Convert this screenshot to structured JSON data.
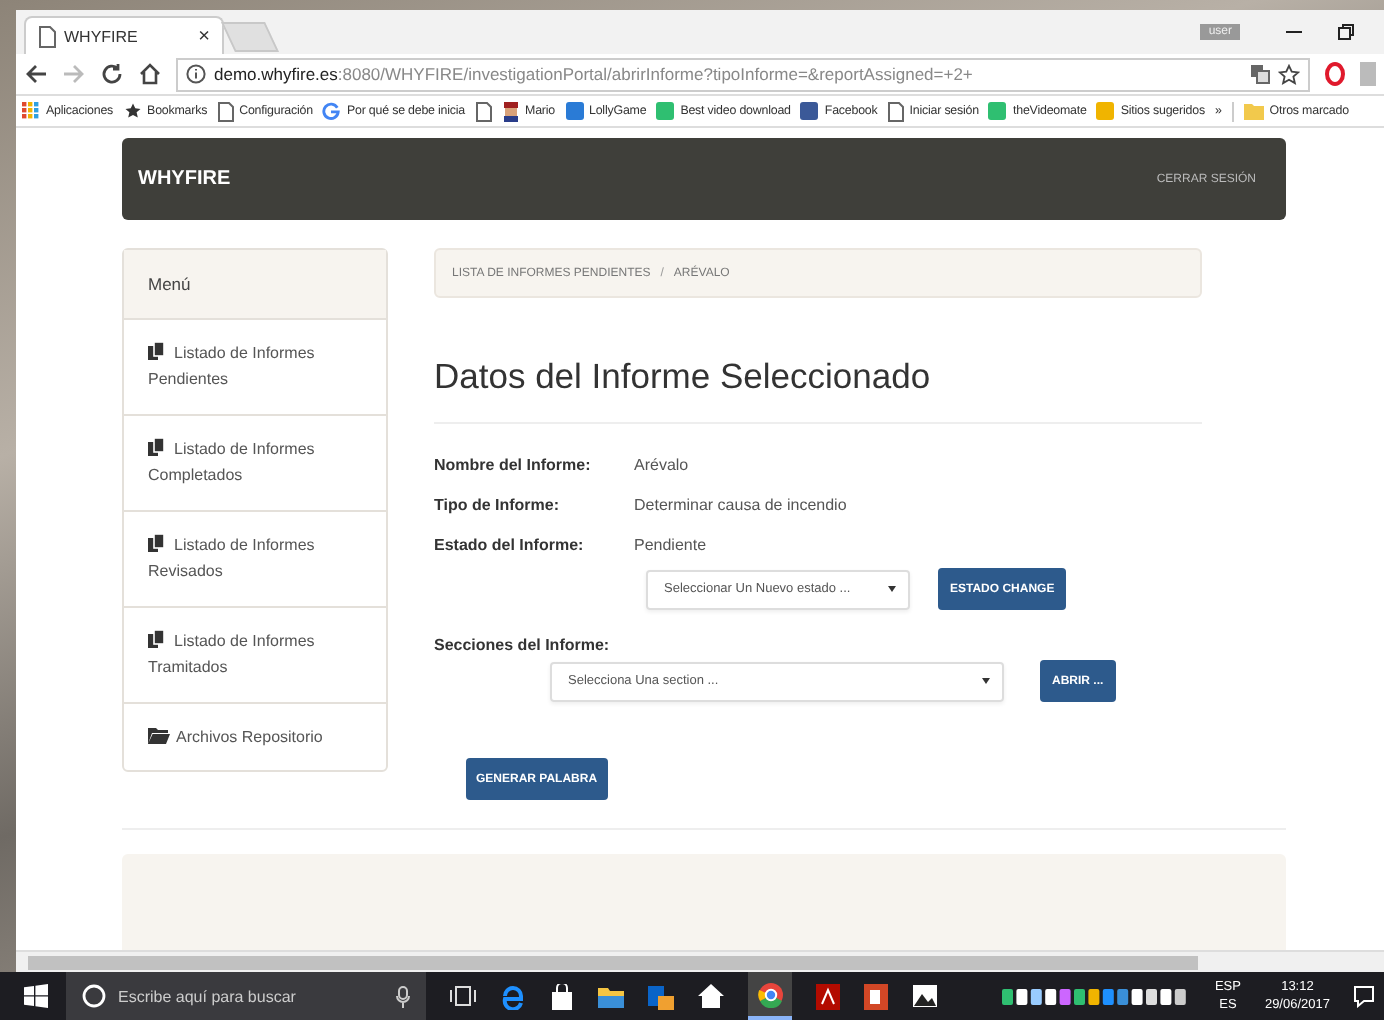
{
  "browser": {
    "tab_title": "WHYFIRE",
    "tab_close": "×",
    "user_badge": "user",
    "url_host": "demo.whyfire.es",
    "url_path": ":8080/WHYFIRE/investigationPortal/abrirInforme?tipoInforme=&reportAssigned=+2+",
    "bookmarks": [
      {
        "kind": "apps",
        "label": "Aplicaciones"
      },
      {
        "kind": "star",
        "label": "Bookmarks"
      },
      {
        "kind": "page",
        "label": "Configuración"
      },
      {
        "kind": "google",
        "label": "Por qué se debe inicia"
      },
      {
        "kind": "page"
      },
      {
        "kind": "mario",
        "label": "Mario"
      },
      {
        "kind": "blue",
        "label": "LollyGame"
      },
      {
        "kind": "green",
        "label": "Best video download"
      },
      {
        "kind": "facebook",
        "label": "Facebook"
      },
      {
        "kind": "page",
        "label": "Iniciar sesión"
      },
      {
        "kind": "green",
        "label": "theVideomate"
      },
      {
        "kind": "bing",
        "label": "Sitios sugeridos"
      }
    ],
    "more": "»",
    "other_bookmarks": "Otros marcado"
  },
  "header": {
    "brand": "WHYFIRE",
    "logout": "CERRAR SESIÓN"
  },
  "sidebar": {
    "title": "Menú",
    "items": [
      {
        "kind": "files",
        "label": "Listado de Informes Pendientes"
      },
      {
        "kind": "files",
        "label": "Listado de Informes Completados"
      },
      {
        "kind": "files",
        "label": "Listado de Informes Revisados"
      },
      {
        "kind": "files",
        "label": "Listado de Informes Tramitados"
      },
      {
        "kind": "folder",
        "label": "Archivos Repositorio"
      }
    ]
  },
  "breadcrumb": [
    "LISTA DE INFORMES PENDIENTES",
    "ARÉVALO"
  ],
  "breadcrumb_separator": "/",
  "title": "Datos del Informe Seleccionado",
  "fields": [
    {
      "label": "Nombre del Informe:",
      "value": "Arévalo"
    },
    {
      "label": "Tipo de Informe:",
      "value": "Determinar causa de incendio"
    },
    {
      "label": "Estado del Informe:",
      "value": "Pendiente"
    }
  ],
  "state_select": {
    "placeholder": "Seleccionar Un Nuevo estado ...",
    "button": "ESTADO CHANGE"
  },
  "sections_label": "Secciones del Informe:",
  "section_select": {
    "placeholder": "Selecciona Una section ...",
    "button": "ABRIR ..."
  },
  "generate_button": "GENERAR PALABRA",
  "taskbar": {
    "search_placeholder": "Escribe aquí para buscar",
    "language": "ESP",
    "layout": "ES",
    "time": "13:12",
    "date": "29/06/2017"
  }
}
